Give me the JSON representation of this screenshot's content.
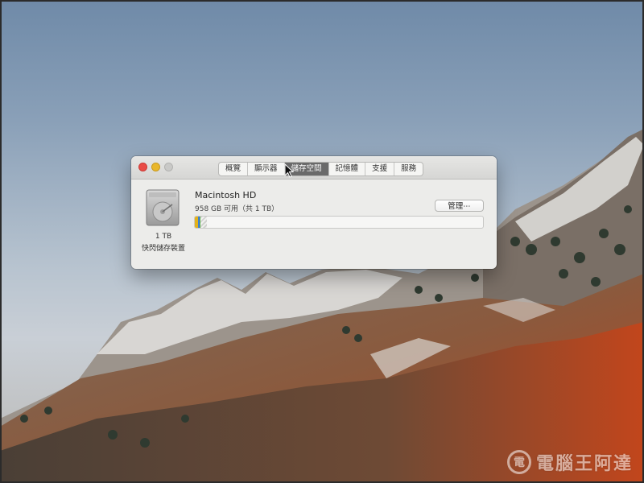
{
  "window": {
    "traffic_lights": {
      "close_color": "#e94c47",
      "minimize_color": "#e9b72c",
      "zoom_color": "#c9c9c7"
    },
    "tabs": [
      {
        "label": "概覽",
        "active": false
      },
      {
        "label": "顯示器",
        "active": false
      },
      {
        "label": "儲存空間",
        "active": true
      },
      {
        "label": "記憶體",
        "active": false
      },
      {
        "label": "支援",
        "active": false
      },
      {
        "label": "服務",
        "active": false
      }
    ]
  },
  "storage": {
    "drive_icon": "hard-drive-icon",
    "drive_capacity": "1 TB",
    "drive_type": "快閃儲存裝置",
    "volume_name": "Macintosh HD",
    "free_text": "958 GB 可用（共 1 TB）",
    "manage_label": "管理⋯",
    "usage_bar": {
      "used_fraction": 0.042,
      "segment_colors": [
        "#e2b21b",
        "#3e7dd6",
        "#58b24a"
      ]
    }
  },
  "watermark": {
    "text": "電腦王阿達",
    "logo_glyph": "電"
  },
  "cursor": "arrow-cursor-icon"
}
